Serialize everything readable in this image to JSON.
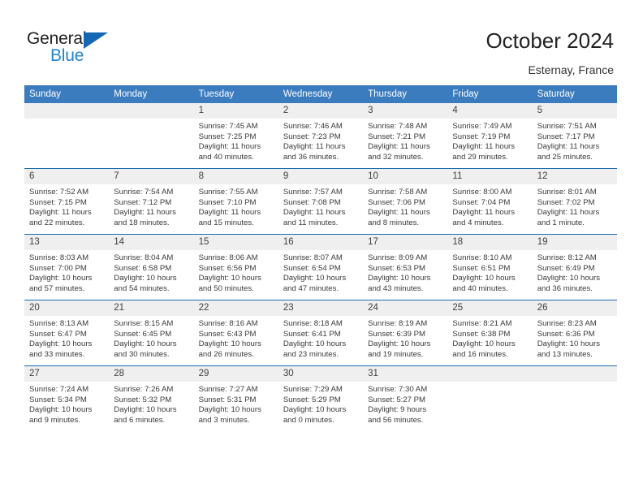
{
  "brand": {
    "name_top": "General",
    "name_bottom": "Blue",
    "triangle_color": "#1268b3",
    "blue_color": "#1e85d2"
  },
  "header": {
    "title": "October 2024",
    "subtitle": "Esternay, France"
  },
  "theme": {
    "header_blue": "#3b7cbf",
    "rule_blue": "#1c6bb0",
    "daynum_bg": "#efefef"
  },
  "weekday_headers": [
    "Sunday",
    "Monday",
    "Tuesday",
    "Wednesday",
    "Thursday",
    "Friday",
    "Saturday"
  ],
  "labels": {
    "sunrise_prefix": "Sunrise:",
    "sunset_prefix": "Sunset:",
    "daylight_prefix": "Daylight:"
  },
  "weeks": [
    [
      {
        "day": "",
        "blank": true
      },
      {
        "day": "",
        "blank": true
      },
      {
        "day": "1",
        "sunrise": "Sunrise: 7:45 AM",
        "sunset": "Sunset: 7:25 PM",
        "daylight_line1": "Daylight: 11 hours",
        "daylight_line2": "and 40 minutes."
      },
      {
        "day": "2",
        "sunrise": "Sunrise: 7:46 AM",
        "sunset": "Sunset: 7:23 PM",
        "daylight_line1": "Daylight: 11 hours",
        "daylight_line2": "and 36 minutes."
      },
      {
        "day": "3",
        "sunrise": "Sunrise: 7:48 AM",
        "sunset": "Sunset: 7:21 PM",
        "daylight_line1": "Daylight: 11 hours",
        "daylight_line2": "and 32 minutes."
      },
      {
        "day": "4",
        "sunrise": "Sunrise: 7:49 AM",
        "sunset": "Sunset: 7:19 PM",
        "daylight_line1": "Daylight: 11 hours",
        "daylight_line2": "and 29 minutes."
      },
      {
        "day": "5",
        "sunrise": "Sunrise: 7:51 AM",
        "sunset": "Sunset: 7:17 PM",
        "daylight_line1": "Daylight: 11 hours",
        "daylight_line2": "and 25 minutes."
      }
    ],
    [
      {
        "day": "6",
        "sunrise": "Sunrise: 7:52 AM",
        "sunset": "Sunset: 7:15 PM",
        "daylight_line1": "Daylight: 11 hours",
        "daylight_line2": "and 22 minutes."
      },
      {
        "day": "7",
        "sunrise": "Sunrise: 7:54 AM",
        "sunset": "Sunset: 7:12 PM",
        "daylight_line1": "Daylight: 11 hours",
        "daylight_line2": "and 18 minutes."
      },
      {
        "day": "8",
        "sunrise": "Sunrise: 7:55 AM",
        "sunset": "Sunset: 7:10 PM",
        "daylight_line1": "Daylight: 11 hours",
        "daylight_line2": "and 15 minutes."
      },
      {
        "day": "9",
        "sunrise": "Sunrise: 7:57 AM",
        "sunset": "Sunset: 7:08 PM",
        "daylight_line1": "Daylight: 11 hours",
        "daylight_line2": "and 11 minutes."
      },
      {
        "day": "10",
        "sunrise": "Sunrise: 7:58 AM",
        "sunset": "Sunset: 7:06 PM",
        "daylight_line1": "Daylight: 11 hours",
        "daylight_line2": "and 8 minutes."
      },
      {
        "day": "11",
        "sunrise": "Sunrise: 8:00 AM",
        "sunset": "Sunset: 7:04 PM",
        "daylight_line1": "Daylight: 11 hours",
        "daylight_line2": "and 4 minutes."
      },
      {
        "day": "12",
        "sunrise": "Sunrise: 8:01 AM",
        "sunset": "Sunset: 7:02 PM",
        "daylight_line1": "Daylight: 11 hours",
        "daylight_line2": "and 1 minute."
      }
    ],
    [
      {
        "day": "13",
        "sunrise": "Sunrise: 8:03 AM",
        "sunset": "Sunset: 7:00 PM",
        "daylight_line1": "Daylight: 10 hours",
        "daylight_line2": "and 57 minutes."
      },
      {
        "day": "14",
        "sunrise": "Sunrise: 8:04 AM",
        "sunset": "Sunset: 6:58 PM",
        "daylight_line1": "Daylight: 10 hours",
        "daylight_line2": "and 54 minutes."
      },
      {
        "day": "15",
        "sunrise": "Sunrise: 8:06 AM",
        "sunset": "Sunset: 6:56 PM",
        "daylight_line1": "Daylight: 10 hours",
        "daylight_line2": "and 50 minutes."
      },
      {
        "day": "16",
        "sunrise": "Sunrise: 8:07 AM",
        "sunset": "Sunset: 6:54 PM",
        "daylight_line1": "Daylight: 10 hours",
        "daylight_line2": "and 47 minutes."
      },
      {
        "day": "17",
        "sunrise": "Sunrise: 8:09 AM",
        "sunset": "Sunset: 6:53 PM",
        "daylight_line1": "Daylight: 10 hours",
        "daylight_line2": "and 43 minutes."
      },
      {
        "day": "18",
        "sunrise": "Sunrise: 8:10 AM",
        "sunset": "Sunset: 6:51 PM",
        "daylight_line1": "Daylight: 10 hours",
        "daylight_line2": "and 40 minutes."
      },
      {
        "day": "19",
        "sunrise": "Sunrise: 8:12 AM",
        "sunset": "Sunset: 6:49 PM",
        "daylight_line1": "Daylight: 10 hours",
        "daylight_line2": "and 36 minutes."
      }
    ],
    [
      {
        "day": "20",
        "sunrise": "Sunrise: 8:13 AM",
        "sunset": "Sunset: 6:47 PM",
        "daylight_line1": "Daylight: 10 hours",
        "daylight_line2": "and 33 minutes."
      },
      {
        "day": "21",
        "sunrise": "Sunrise: 8:15 AM",
        "sunset": "Sunset: 6:45 PM",
        "daylight_line1": "Daylight: 10 hours",
        "daylight_line2": "and 30 minutes."
      },
      {
        "day": "22",
        "sunrise": "Sunrise: 8:16 AM",
        "sunset": "Sunset: 6:43 PM",
        "daylight_line1": "Daylight: 10 hours",
        "daylight_line2": "and 26 minutes."
      },
      {
        "day": "23",
        "sunrise": "Sunrise: 8:18 AM",
        "sunset": "Sunset: 6:41 PM",
        "daylight_line1": "Daylight: 10 hours",
        "daylight_line2": "and 23 minutes."
      },
      {
        "day": "24",
        "sunrise": "Sunrise: 8:19 AM",
        "sunset": "Sunset: 6:39 PM",
        "daylight_line1": "Daylight: 10 hours",
        "daylight_line2": "and 19 minutes."
      },
      {
        "day": "25",
        "sunrise": "Sunrise: 8:21 AM",
        "sunset": "Sunset: 6:38 PM",
        "daylight_line1": "Daylight: 10 hours",
        "daylight_line2": "and 16 minutes."
      },
      {
        "day": "26",
        "sunrise": "Sunrise: 8:23 AM",
        "sunset": "Sunset: 6:36 PM",
        "daylight_line1": "Daylight: 10 hours",
        "daylight_line2": "and 13 minutes."
      }
    ],
    [
      {
        "day": "27",
        "sunrise": "Sunrise: 7:24 AM",
        "sunset": "Sunset: 5:34 PM",
        "daylight_line1": "Daylight: 10 hours",
        "daylight_line2": "and 9 minutes."
      },
      {
        "day": "28",
        "sunrise": "Sunrise: 7:26 AM",
        "sunset": "Sunset: 5:32 PM",
        "daylight_line1": "Daylight: 10 hours",
        "daylight_line2": "and 6 minutes."
      },
      {
        "day": "29",
        "sunrise": "Sunrise: 7:27 AM",
        "sunset": "Sunset: 5:31 PM",
        "daylight_line1": "Daylight: 10 hours",
        "daylight_line2": "and 3 minutes."
      },
      {
        "day": "30",
        "sunrise": "Sunrise: 7:29 AM",
        "sunset": "Sunset: 5:29 PM",
        "daylight_line1": "Daylight: 10 hours",
        "daylight_line2": "and 0 minutes."
      },
      {
        "day": "31",
        "sunrise": "Sunrise: 7:30 AM",
        "sunset": "Sunset: 5:27 PM",
        "daylight_line1": "Daylight: 9 hours",
        "daylight_line2": "and 56 minutes."
      },
      {
        "day": "",
        "blank": true
      },
      {
        "day": "",
        "blank": true
      }
    ]
  ]
}
